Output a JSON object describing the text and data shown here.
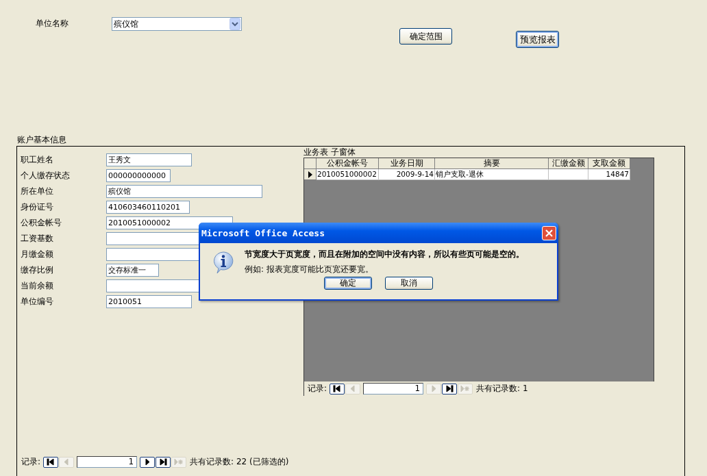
{
  "header": {
    "unit_label": "单位名称",
    "unit_value": "殡仪馆",
    "buttons": [
      {
        "label": "确定范围",
        "focused": false
      },
      {
        "label": "预览报表",
        "focused": true
      }
    ]
  },
  "account": {
    "title": "账户基本信息",
    "fields": [
      {
        "label": "职工姓名",
        "value": "王秀文"
      },
      {
        "label": "个人缴存状态",
        "value": "000000000000"
      },
      {
        "label": "所在单位",
        "value": "殡仪馆"
      },
      {
        "label": "身份证号",
        "value": "410603460110201"
      },
      {
        "label": "公积金帐号",
        "value": "2010051000002"
      },
      {
        "label": "工资基数"
      },
      {
        "label": "月缴金额"
      },
      {
        "label": "缴存比例",
        "value": "交存标准一"
      },
      {
        "label": "当前余额"
      },
      {
        "label": "单位编号",
        "value": "2010051"
      }
    ]
  },
  "subform": {
    "title": "业务表 子窗体",
    "columns": [
      "公积金帐号",
      "业务日期",
      "摘要",
      "汇缴金额",
      "支取金额"
    ],
    "rows": [
      {
        "current": true,
        "cells": [
          "2010051000002",
          "2009-9-14",
          "销户支取-退休",
          "",
          "14847"
        ]
      }
    ],
    "navigation": {
      "label": "记录:",
      "current": "1",
      "total": "共有记录数: 1",
      "buttons": [
        {
          "kind": "first",
          "disabled": false
        },
        {
          "kind": "prev",
          "disabled": true
        },
        {
          "kind": "next",
          "disabled": true
        },
        {
          "kind": "last",
          "disabled": false
        },
        {
          "kind": "new",
          "disabled": true
        }
      ]
    }
  },
  "navigation": {
    "label": "记录:",
    "current": "1",
    "total": "共有记录数: 22 (已筛选的)",
    "buttons": [
      {
        "kind": "first",
        "disabled": false
      },
      {
        "kind": "prev",
        "disabled": true
      },
      {
        "kind": "next",
        "disabled": false
      },
      {
        "kind": "last",
        "disabled": false
      },
      {
        "kind": "new",
        "disabled": true
      }
    ]
  },
  "dialog": {
    "title": "Microsoft Office Access",
    "message": "节宽度大于页宽度，而且在附加的空间中没有内容，所以有些页可能是空的。",
    "detail": "例如: 报表宽度可能比页宽还要宽。",
    "buttons": [
      {
        "label": "确定",
        "focused": true
      },
      {
        "label": "取消",
        "focused": false
      }
    ]
  }
}
